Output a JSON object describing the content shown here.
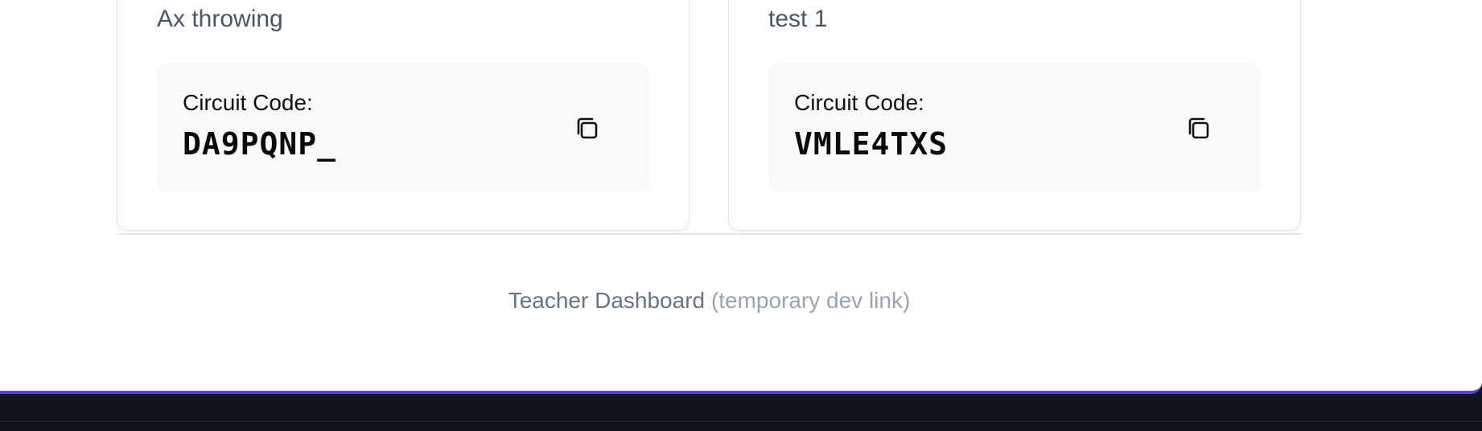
{
  "circuits": [
    {
      "title": "Ax throwing",
      "code_label": "Circuit Code:",
      "code": "DA9PQNP_",
      "copy_icon": "copy-icon"
    },
    {
      "title": "test 1",
      "code_label": "Circuit Code:",
      "code": "VMLE4TXS",
      "copy_icon": "copy-icon"
    }
  ],
  "footer": {
    "link_text": "Teacher Dashboard",
    "note": "(temporary dev link)"
  },
  "colors": {
    "accent_border": "#5b3fd6",
    "background_dark": "#11141c",
    "code_box_bg": "#f8f9fb"
  }
}
